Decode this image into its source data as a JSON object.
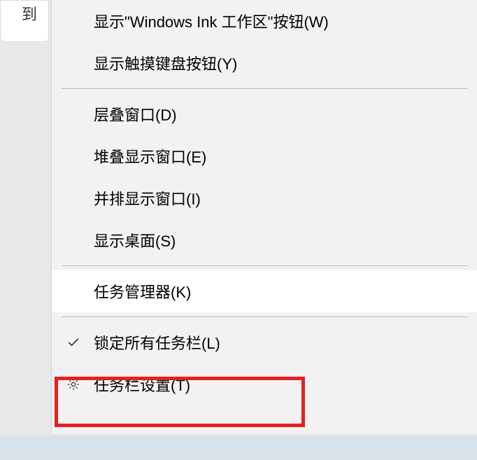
{
  "bgFragmentText": "到",
  "menu": {
    "items": [
      {
        "label": "显示\"Windows Ink 工作区\"按钮(W)"
      },
      {
        "label": "显示触摸键盘按钮(Y)"
      }
    ],
    "windowItems": [
      {
        "label": "层叠窗口(D)"
      },
      {
        "label": "堆叠显示窗口(E)"
      },
      {
        "label": "并排显示窗口(I)"
      },
      {
        "label": "显示桌面(S)"
      }
    ],
    "taskManager": {
      "label": "任务管理器(K)"
    },
    "lockTaskbar": {
      "label": "锁定所有任务栏(L)"
    },
    "taskbarSettings": {
      "label": "任务栏设置(T)"
    }
  }
}
